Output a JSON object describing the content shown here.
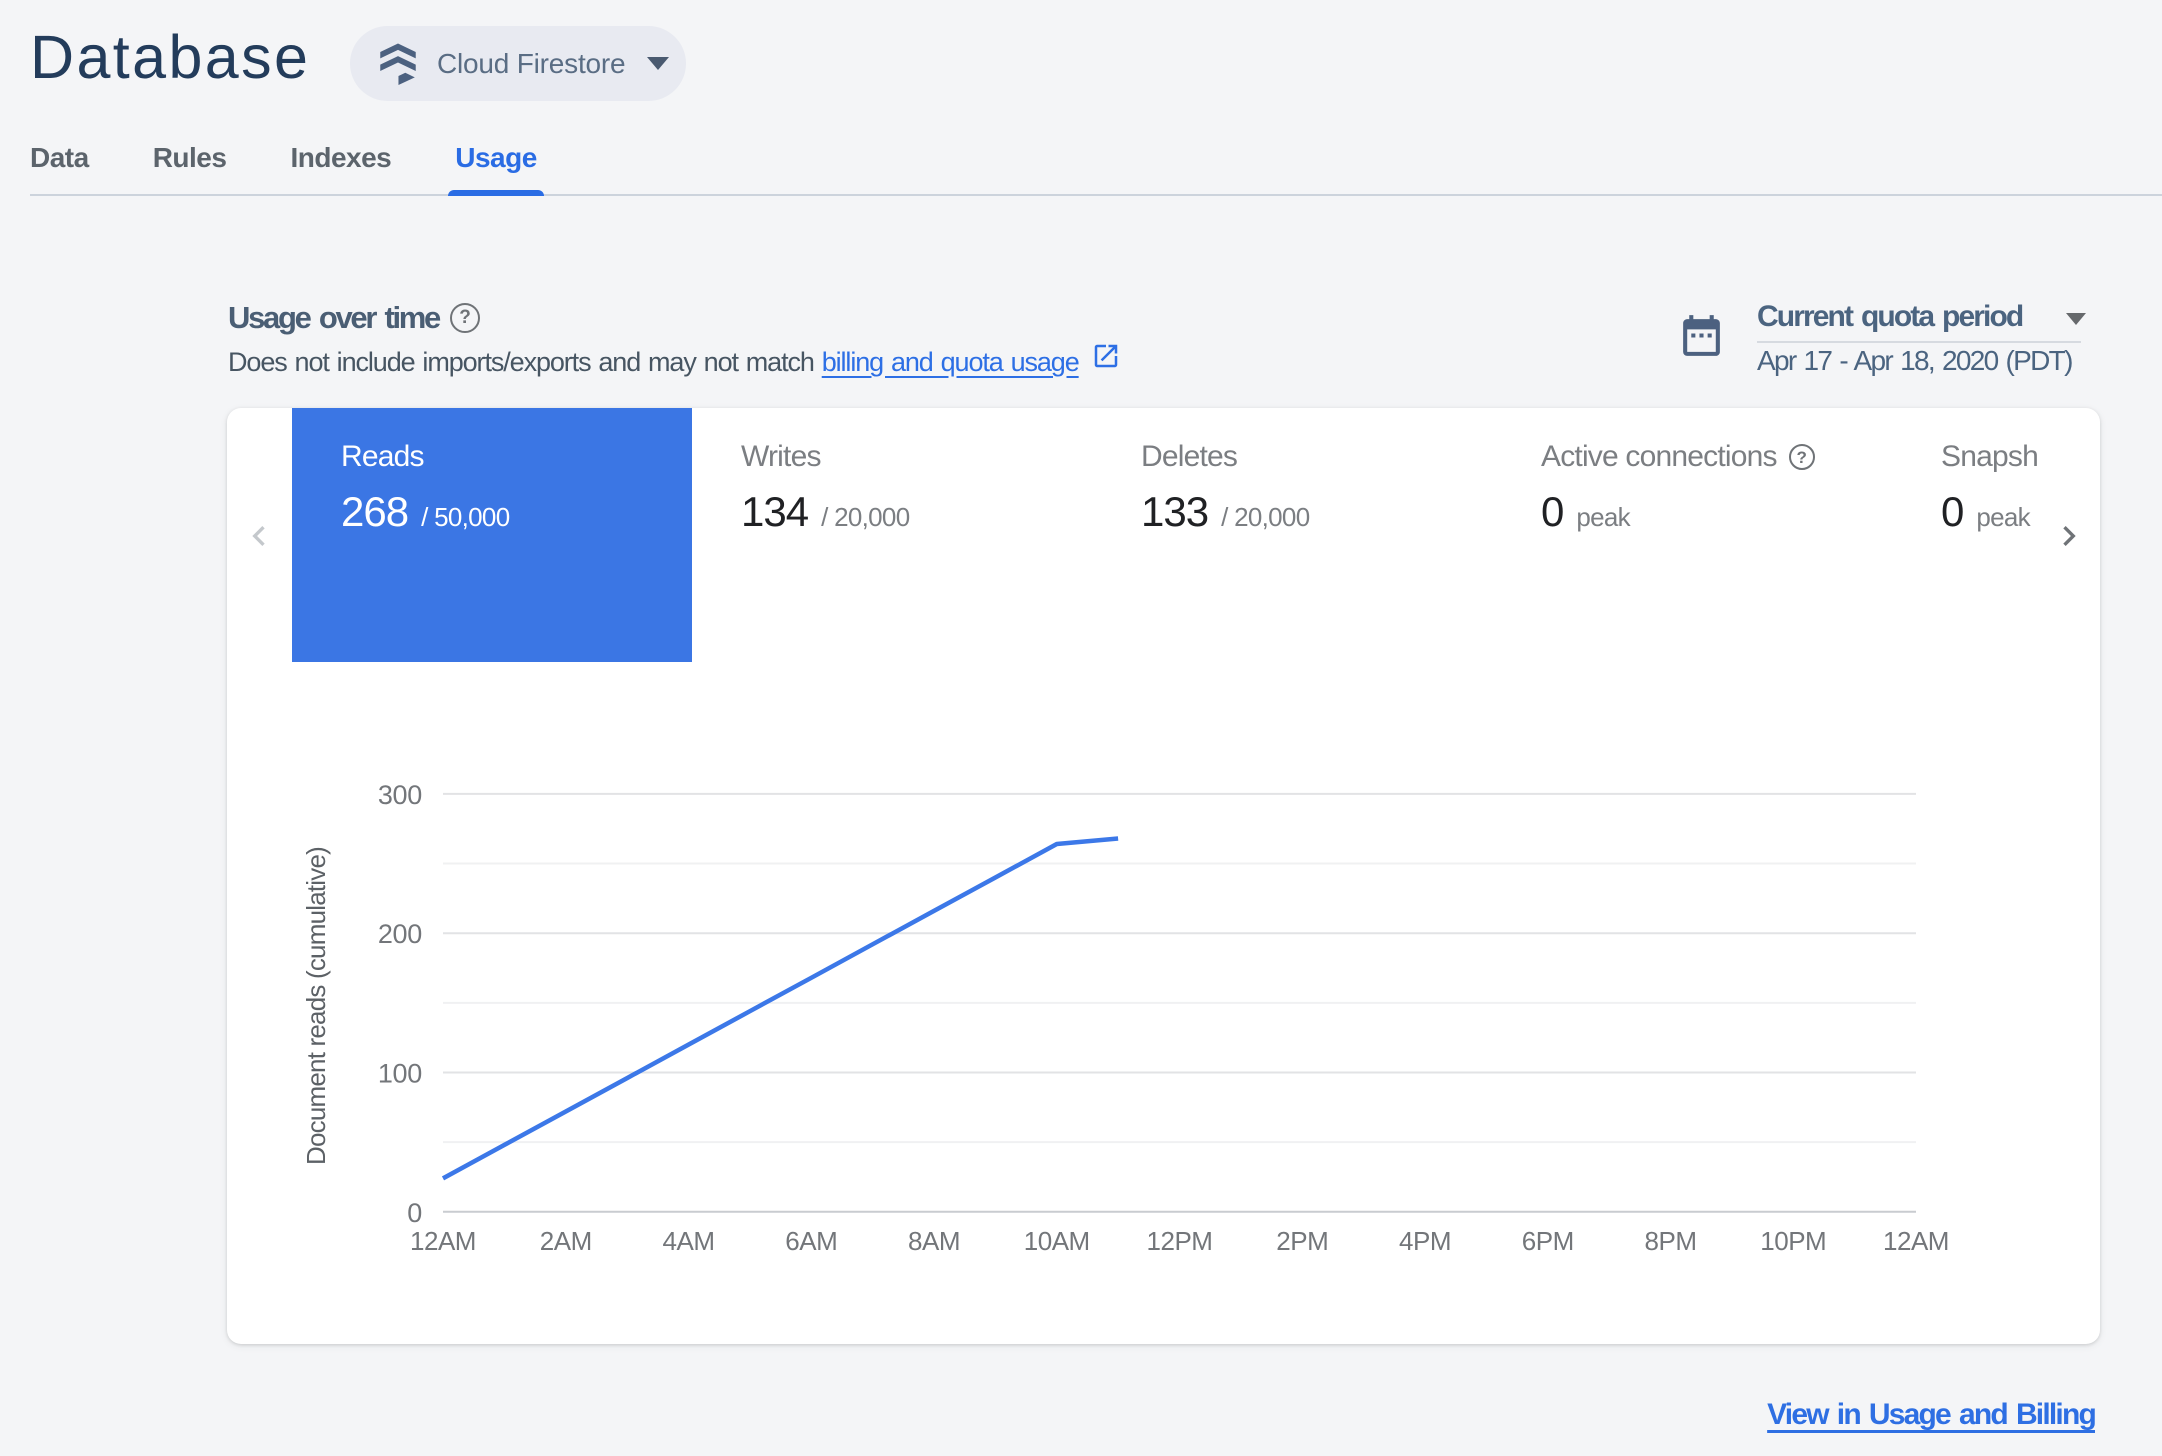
{
  "header": {
    "title": "Database",
    "product_selector": {
      "label": "Cloud Firestore"
    },
    "tabs": [
      {
        "label": "Data"
      },
      {
        "label": "Rules"
      },
      {
        "label": "Indexes"
      },
      {
        "label": "Usage",
        "active": true
      }
    ]
  },
  "usage_section": {
    "heading": "Usage over time",
    "help_glyph": "?",
    "subtitle_prefix": "Does not include imports/exports and may not match",
    "subtitle_link": "billing and quota usage",
    "quota_period": {
      "selected": "Current quota period",
      "range": "Apr 17 - Apr 18, 2020 (PDT)"
    }
  },
  "metrics": {
    "items": [
      {
        "label": "Reads",
        "value": "268",
        "suffix": "/ 50,000",
        "selected": true
      },
      {
        "label": "Writes",
        "value": "134",
        "suffix": "/ 20,000"
      },
      {
        "label": "Deletes",
        "value": "133",
        "suffix": "/ 20,000"
      },
      {
        "label": "Active connections",
        "value": "0",
        "suffix": "peak",
        "help": true
      },
      {
        "label": "Snapshot listeners",
        "value": "0",
        "suffix": "peak"
      }
    ]
  },
  "chart_data": {
    "type": "line",
    "title": "",
    "xlabel": "",
    "ylabel": "Document reads (cumulative)",
    "ylim": [
      0,
      300
    ],
    "yticks": [
      0,
      100,
      200,
      300
    ],
    "yticks_minor": [
      50,
      150,
      250
    ],
    "x_range_hours": [
      0,
      24
    ],
    "xtick_hours": [
      0,
      2,
      4,
      6,
      8,
      10,
      12,
      14,
      16,
      18,
      20,
      22,
      24
    ],
    "xtick_labels": [
      "12AM",
      "2AM",
      "4AM",
      "6AM",
      "8AM",
      "10AM",
      "12PM",
      "2PM",
      "4PM",
      "6PM",
      "8PM",
      "10PM",
      "12AM"
    ],
    "series": [
      {
        "name": "Document reads (cumulative)",
        "x_hours": [
          0,
          1,
          2,
          3,
          4,
          5,
          6,
          7,
          8,
          9,
          10,
          11
        ],
        "values": [
          24,
          48,
          72,
          96,
          120,
          144,
          168,
          192,
          216,
          240,
          264,
          268
        ]
      }
    ],
    "grid": true,
    "legend_position": "none",
    "line_color": "#3c78e8"
  },
  "footer": {
    "link_label": "View in Usage and Billing"
  },
  "colors": {
    "accent_blue": "#2a6ce4",
    "link_blue": "#2d6fe5",
    "selected_tab_blue": "#3b76e4",
    "chart_line_blue": "#3c78e8",
    "navy_title": "#233c5b",
    "slate": "#4c6180",
    "page_bg": "#f4f5f7"
  }
}
